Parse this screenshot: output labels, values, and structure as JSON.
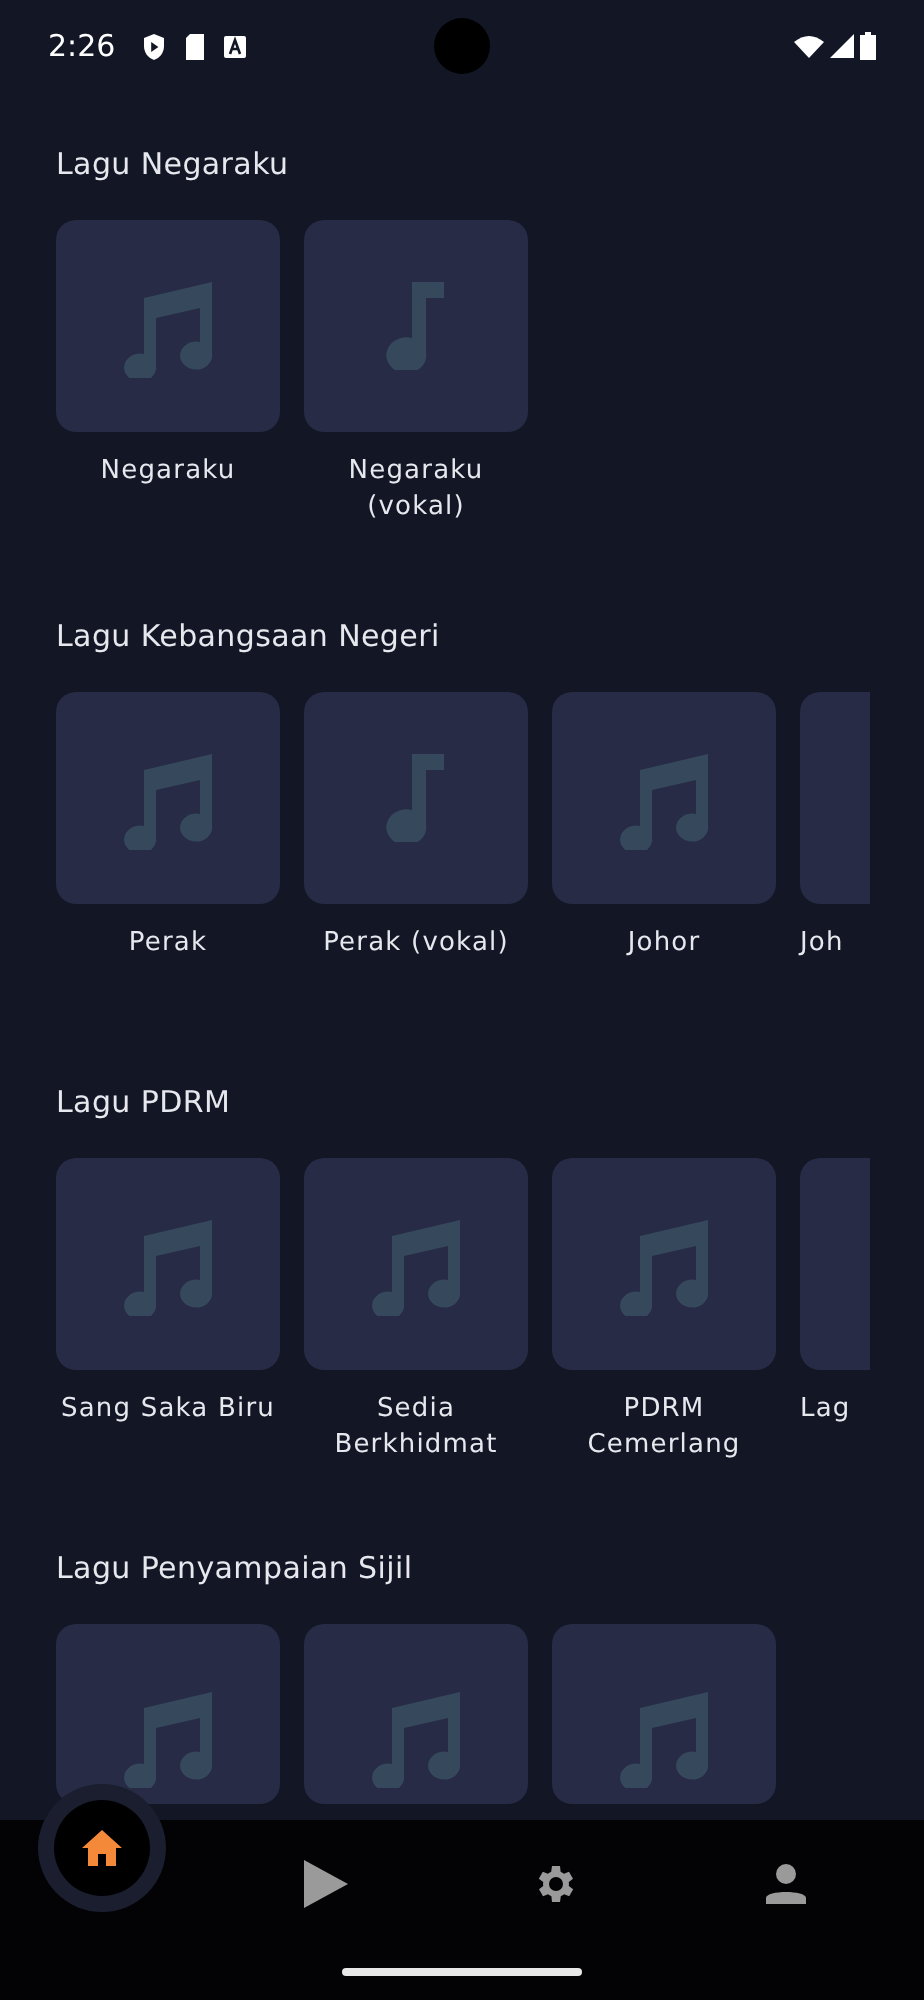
{
  "status_bar": {
    "time": "2:26"
  },
  "sections": [
    {
      "title": "Lagu Negaraku",
      "items": [
        {
          "label": "Negaraku",
          "kind": "double-note",
          "partial": false
        },
        {
          "label": "Negaraku (vokal)",
          "kind": "single-note",
          "partial": false
        }
      ]
    },
    {
      "title": "Lagu Kebangsaan Negeri",
      "items": [
        {
          "label": "Perak",
          "kind": "double-note",
          "partial": false
        },
        {
          "label": "Perak (vokal)",
          "kind": "single-note",
          "partial": false
        },
        {
          "label": "Johor",
          "kind": "double-note",
          "partial": false
        },
        {
          "label": "Joh",
          "kind": "blank",
          "partial": true
        }
      ]
    },
    {
      "title": "Lagu PDRM",
      "items": [
        {
          "label": "Sang Saka Biru",
          "kind": "double-note",
          "partial": false
        },
        {
          "label": "Sedia Berkhidmat",
          "kind": "double-note",
          "partial": false
        },
        {
          "label": "PDRM Cemerlang",
          "kind": "double-note",
          "partial": false
        },
        {
          "label": "Lag",
          "kind": "blank",
          "partial": true
        }
      ]
    },
    {
      "title": "Lagu Penyampaian Sijil",
      "items": [
        {
          "kind": "double-note",
          "partial": false
        },
        {
          "kind": "double-note",
          "partial": false
        },
        {
          "kind": "double-note",
          "partial": false
        }
      ]
    }
  ],
  "nav": [
    {
      "kind": "home",
      "selected": true
    },
    {
      "kind": "play",
      "selected": false
    },
    {
      "kind": "settings",
      "selected": false
    },
    {
      "kind": "profile",
      "selected": false
    }
  ]
}
